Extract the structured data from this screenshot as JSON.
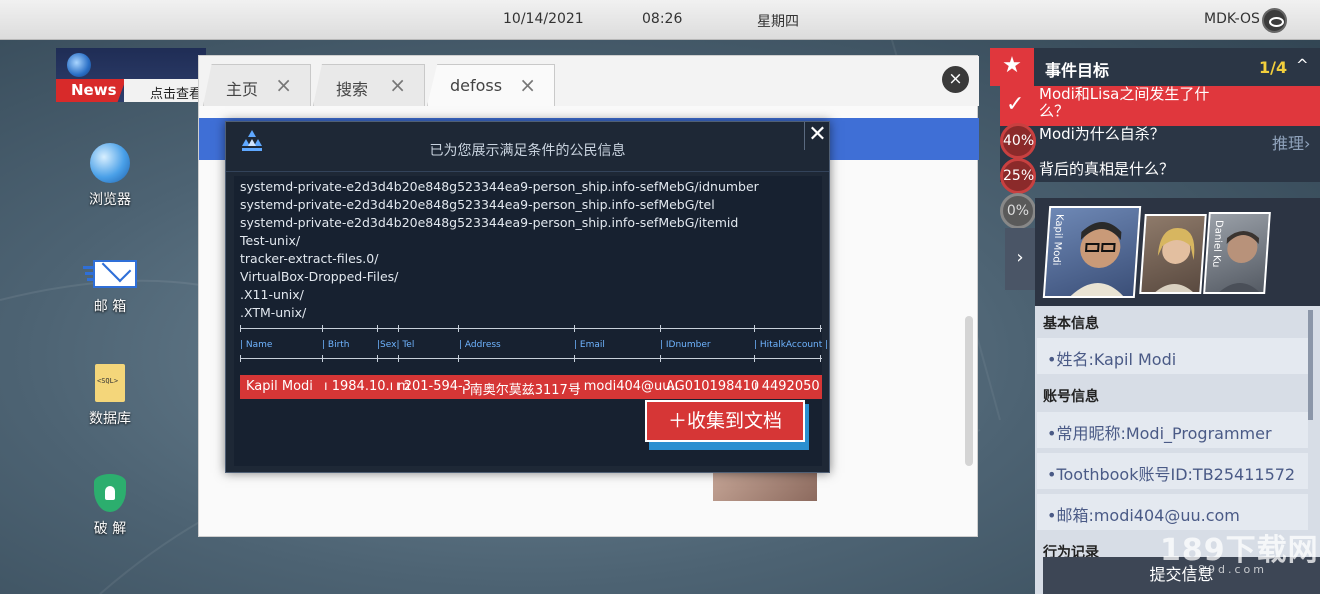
{
  "topbar": {
    "date": "10/14/2021",
    "time": "08:26",
    "weekday": "星期四",
    "os_name": "MDK-OS"
  },
  "news": {
    "badge": "News",
    "ticker": "点击查看"
  },
  "desktop": {
    "icons": [
      {
        "label": "浏览器",
        "icon": "globe-icon"
      },
      {
        "label": "邮 箱",
        "icon": "mail-icon"
      },
      {
        "label": "数据库",
        "icon": "database-icon",
        "file_tag": "<SQL>"
      },
      {
        "label": "破 解",
        "icon": "shield-lock-icon"
      }
    ]
  },
  "browser": {
    "tabs": [
      {
        "label": "主页",
        "close": "×"
      },
      {
        "label": "搜索",
        "close": "×"
      },
      {
        "label": "defoss",
        "close": "×"
      }
    ],
    "close": "×"
  },
  "popup": {
    "title": "已为您展示满足条件的公民信息",
    "close": "✕",
    "lines": [
      "systemd-private-e2d3d4b20e848g523344ea9-person_ship.info-sefMebG/idnumber",
      "systemd-private-e2d3d4b20e848g523344ea9-person_ship.info-sefMebG/tel",
      "systemd-private-e2d3d4b20e848g523344ea9-person_ship.info-sefMebG/itemid",
      "Test-unix/",
      "tracker-extract-files.0/",
      "VirtualBox-Dropped-Files/",
      ".X11-unix/",
      ".XTM-unix/"
    ],
    "headers": [
      "| Name",
      "| Birth",
      "|Sex| Tel",
      "| Address",
      "| Email",
      "| IDnumber",
      "| HitalkAccount |"
    ],
    "result": [
      "Kapil Modi",
      "ı 1984.10.ı m",
      "ı 201-594-3",
      "ı 南奥尔莫兹3117号",
      "ı modi404@uu.ı",
      "AG010198410",
      "ı 4492050"
    ],
    "collect_button": "＋收集到文档"
  },
  "goals": {
    "title": "事件目标",
    "count": "1/4",
    "caret": "^",
    "star": "★",
    "items": [
      {
        "text_line1": "Modi和Lisa之间发生了什",
        "text_line2": "么？",
        "status": "✓"
      },
      {
        "text": "Modi为什么自杀？",
        "pct": "40%"
      },
      {
        "text": "背后的真相是什么？",
        "pct": "25%"
      },
      {
        "pct": "0%"
      }
    ],
    "reason_link": "推理›"
  },
  "character": {
    "expand": "›",
    "portraits": [
      {
        "name": "Kapil Modi"
      },
      {
        "name": ""
      },
      {
        "name": "Daniel Ku"
      }
    ]
  },
  "info": {
    "basic_title": "基本信息",
    "name_row": "•姓名:Kapil Modi",
    "account_title": "账号信息",
    "nickname_row": "•常用昵称:Modi_Programmer",
    "toothbook_row": "•Toothbook账号ID:TB25411572",
    "email_row": "•邮箱:modi404@uu.com",
    "behavior_title": "行为记录",
    "submit": "提交信息"
  },
  "watermark": {
    "main": "189下载网",
    "sub": "189d.com"
  },
  "colors": {
    "accent_red": "#d63636",
    "accent_blue": "#3f6fd6",
    "gold": "#f2cf3c",
    "panel_dark": "#1e2836"
  }
}
